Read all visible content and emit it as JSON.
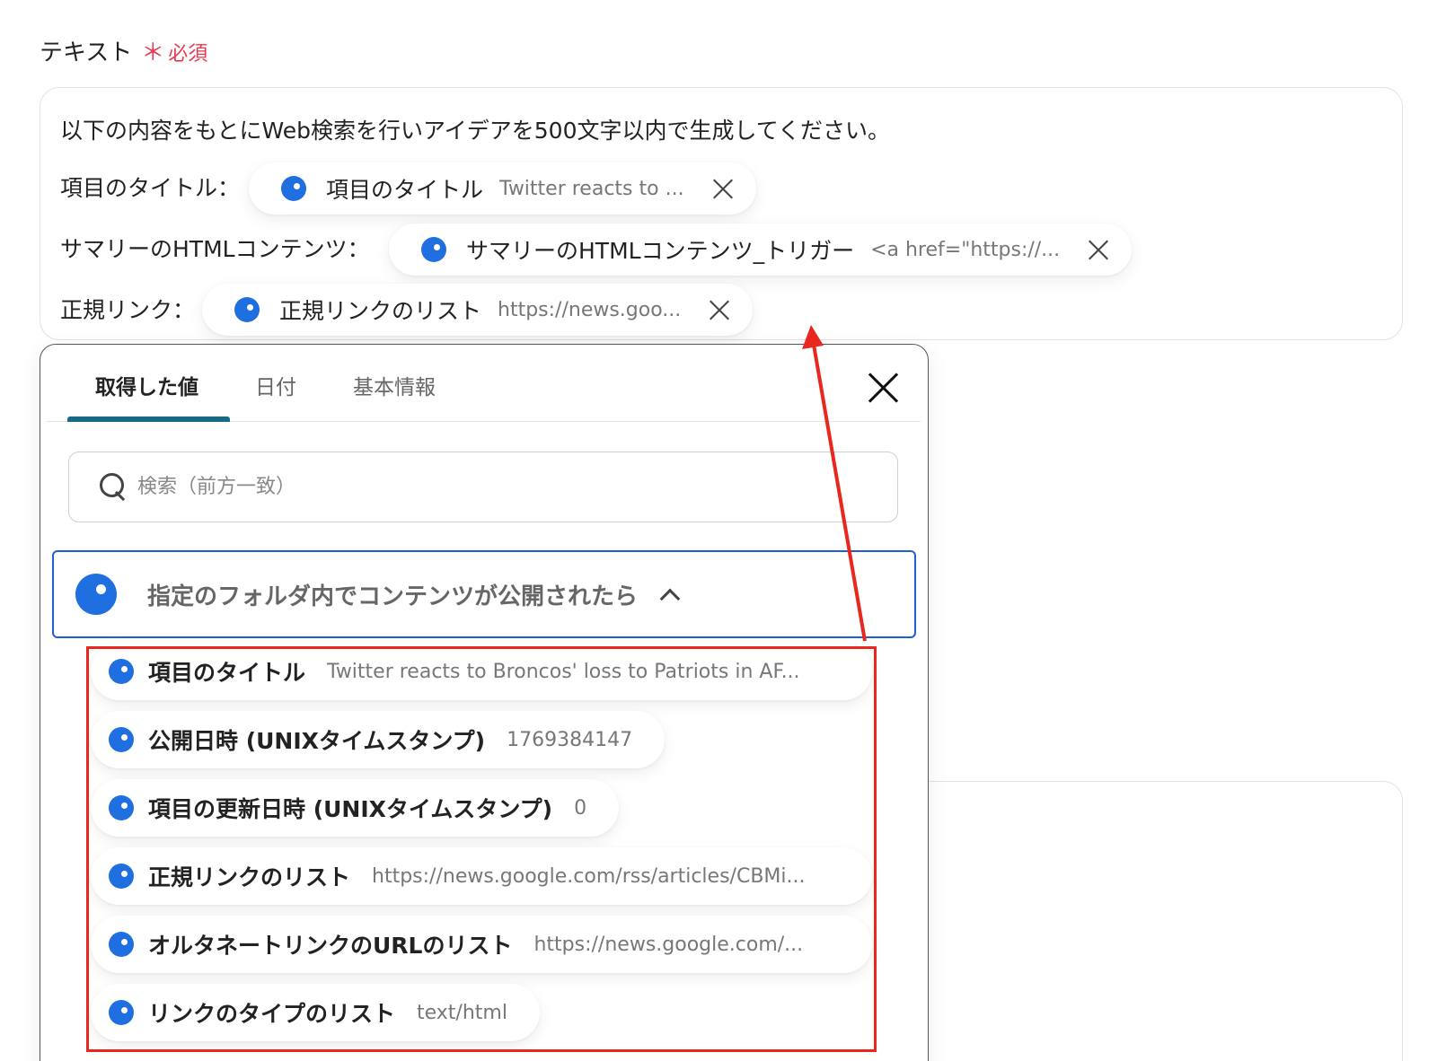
{
  "field": {
    "label": "テキスト",
    "required_star": "＊",
    "required_text": "必須"
  },
  "prompt": {
    "text": "以下の内容をもとにWeb検索を行いアイデアを500文字以内で生成してください。",
    "rows": [
      {
        "label": "項目のタイトル：",
        "chip_label": "項目のタイトル",
        "chip_value": "Twitter reacts to ..."
      },
      {
        "label": "サマリーのHTMLコンテンツ：",
        "chip_label": "サマリーのHTMLコンテンツ_トリガー",
        "chip_value": "<a href=\"https://..."
      },
      {
        "label": "正規リンク：",
        "chip_label": "正規リンクのリスト",
        "chip_value": "https://news.goo..."
      }
    ]
  },
  "popup": {
    "tabs": [
      "取得した値",
      "日付",
      "基本情報"
    ],
    "active_tab": 0,
    "search_placeholder": "検索（前方一致）",
    "group_title": "指定のフォルダ内でコンテンツが公開されたら",
    "items": [
      {
        "label": "項目のタイトル",
        "value": "Twitter reacts to Broncos' loss to Patriots in AF..."
      },
      {
        "label": "公開日時 (UNIXタイムスタンプ)",
        "value": "1769384147"
      },
      {
        "label": "項目の更新日時 (UNIXタイムスタンプ)",
        "value": "0"
      },
      {
        "label": "正規リンクのリスト",
        "value": "https://news.google.com/rss/articles/CBMi..."
      },
      {
        "label": "オルタネートリンクのURLのリスト",
        "value": "https://news.google.com/..."
      },
      {
        "label": "リンクのタイプのリスト",
        "value": "text/html"
      }
    ]
  },
  "colors": {
    "accent": "#1f6fe0",
    "tab_indicator": "#176a86",
    "annotation": "#e8281e",
    "required": "#e8384f"
  }
}
